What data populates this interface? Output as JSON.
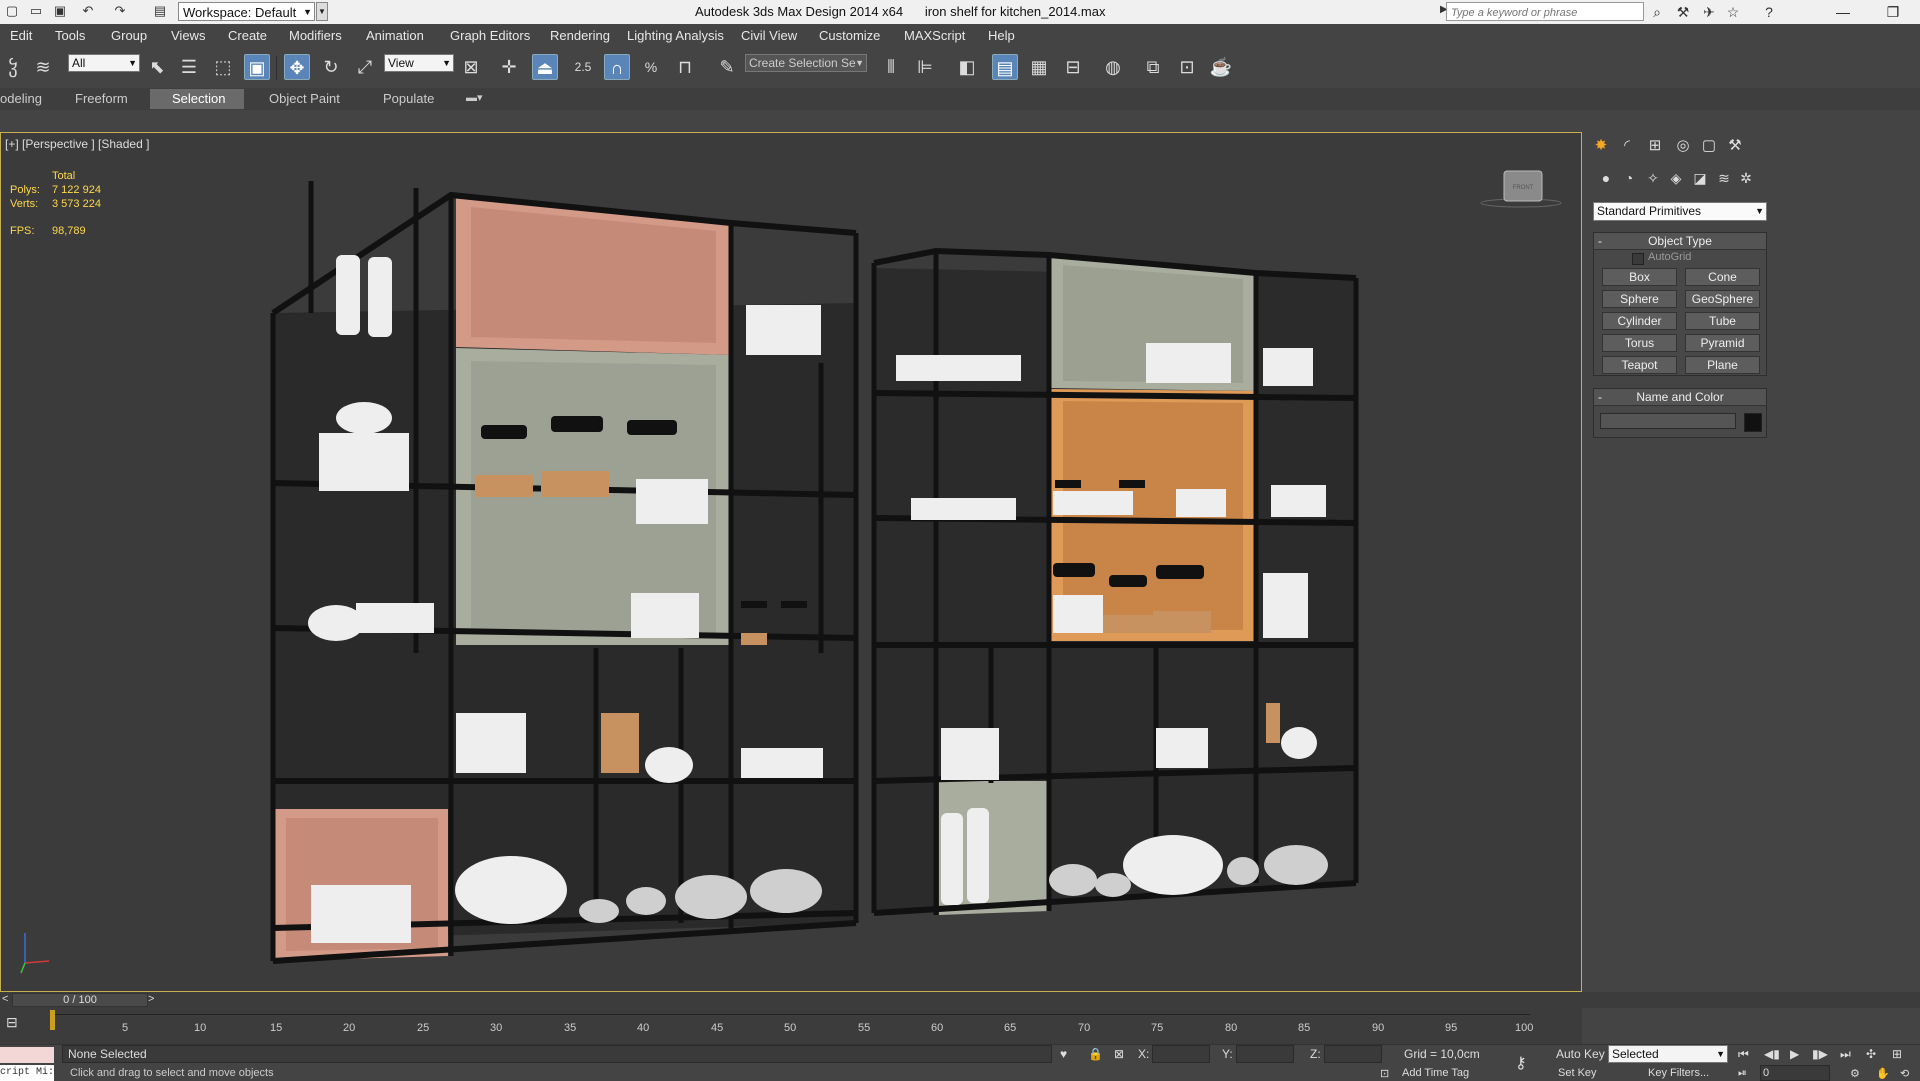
{
  "titlebar": {
    "workspace": "Workspace: Default",
    "app": "Autodesk 3ds Max Design 2014 x64",
    "file": "iron shelf for kitchen_2014.max",
    "search_placeholder": "Type a keyword or phrase"
  },
  "menu": [
    "Edit",
    "Tools",
    "Group",
    "Views",
    "Create",
    "Modifiers",
    "Animation",
    "Graph Editors",
    "Rendering",
    "Lighting Analysis",
    "Civil View",
    "Customize",
    "MAXScript",
    "Help"
  ],
  "toolbar": {
    "filter": "All",
    "ref_coord": "View",
    "snap_value": "2.5",
    "selection_set": "Create Selection Se"
  },
  "ribbon_tabs": [
    "odeling",
    "Freeform",
    "Selection",
    "Object Paint",
    "Populate"
  ],
  "viewport": {
    "label": "[+] [Perspective ] [Shaded ]",
    "stats": {
      "total_label": "Total",
      "polys_label": "Polys:",
      "polys": "7 122 924",
      "verts_label": "Verts:",
      "verts": "3 573 224",
      "fps_label": "FPS:",
      "fps": "98,789"
    },
    "viewcube": "FRONT"
  },
  "command_panel": {
    "category": "Standard Primitives",
    "object_type": {
      "title": "Object Type",
      "autogrid": "AutoGrid",
      "buttons": [
        "Box",
        "Cone",
        "Sphere",
        "GeoSphere",
        "Cylinder",
        "Tube",
        "Torus",
        "Pyramid",
        "Teapot",
        "Plane"
      ]
    },
    "name_and_color": {
      "title": "Name and Color",
      "color": "#111111"
    }
  },
  "timeline": {
    "frame": "0 / 100",
    "ticks": [
      "5",
      "10",
      "15",
      "20",
      "25",
      "30",
      "35",
      "40",
      "45",
      "50",
      "55",
      "60",
      "65",
      "70",
      "75",
      "80",
      "85",
      "90",
      "95",
      "100"
    ]
  },
  "status": {
    "selection": "None Selected",
    "prompt": "Click and drag to select and move objects",
    "x_label": "X:",
    "y_label": "Y:",
    "z_label": "Z:",
    "grid": "Grid = 10,0cm",
    "add_time_tag": "Add Time Tag",
    "auto_key": "Auto Key",
    "set_key": "Set Key",
    "key_mode": "Selected",
    "key_filters": "Key Filters...",
    "current_frame": "0",
    "maxscript": "cript Mi:"
  },
  "colors": {
    "accent": "#5a85b8",
    "pink_box": "#d49a88",
    "sage_box": "#a8ad9e",
    "orange_box": "#e09a58",
    "viewport_border": "#c8b050"
  }
}
